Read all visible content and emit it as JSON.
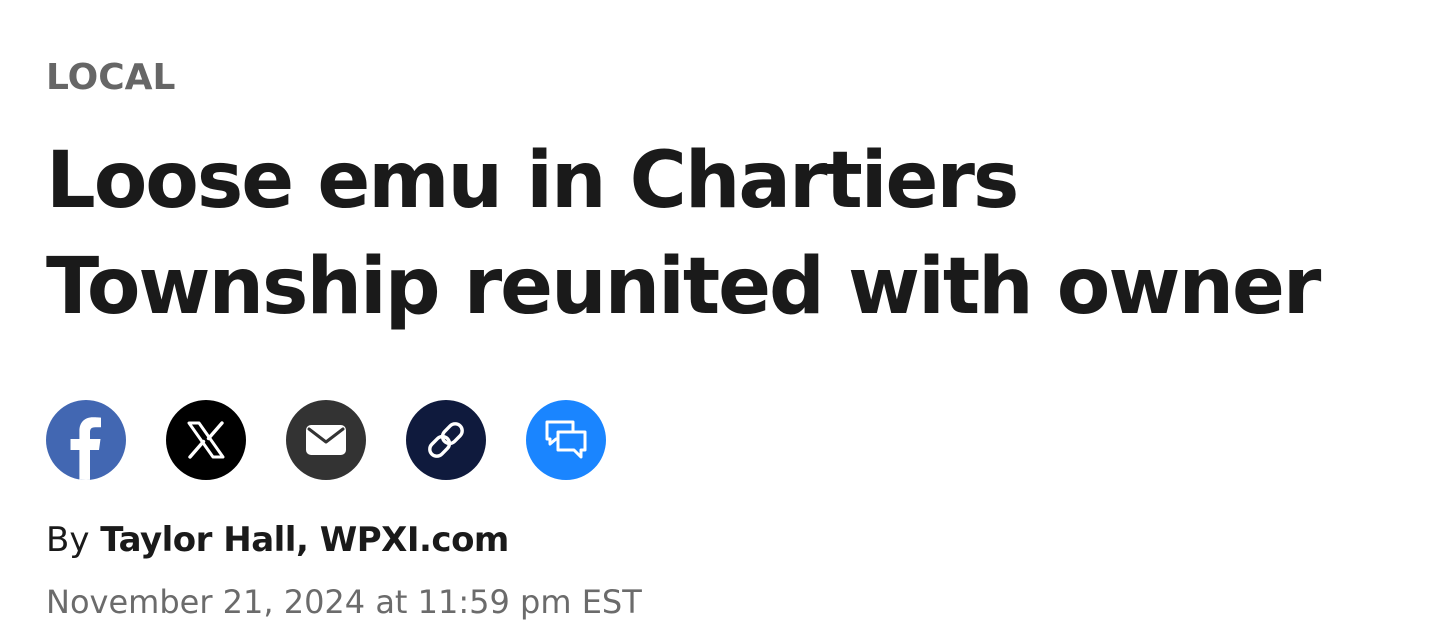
{
  "article": {
    "category": "LOCAL",
    "headline_line1": "Loose emu in Chartiers",
    "headline_line2": "Township reunited with owner",
    "byline_prefix": "By",
    "author": "Taylor Hall, WPXI.com",
    "timestamp": "November 21, 2024 at 11:59 pm EST"
  },
  "share": {
    "buttons": [
      {
        "icon": "facebook-icon",
        "color": "#4267B2"
      },
      {
        "icon": "x-icon",
        "color": "#000000"
      },
      {
        "icon": "email-icon",
        "color": "#333333"
      },
      {
        "icon": "link-icon",
        "color": "#0F1A3D"
      },
      {
        "icon": "comments-icon",
        "color": "#1A85FF"
      }
    ]
  }
}
